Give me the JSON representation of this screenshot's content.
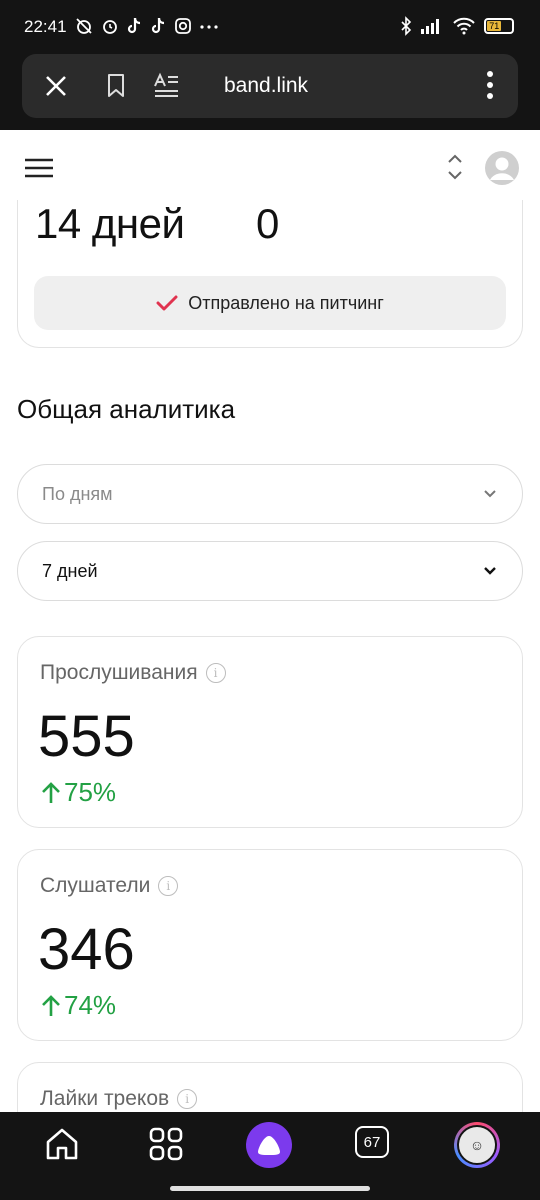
{
  "status_bar": {
    "time": "22:41",
    "battery_label": "71"
  },
  "browser": {
    "url": "band.link",
    "close_icon": "close-icon",
    "bookmark_icon": "bookmark-icon",
    "reader_icon": "reader-mode-icon",
    "menu_icon": "more-vertical-icon"
  },
  "header": {
    "menu_icon": "hamburger-icon",
    "sort_icon": "sort-updown-icon",
    "profile_icon": "profile-icon"
  },
  "pitching": {
    "days": "14 дней",
    "count": "0",
    "status": "Отправлено на питчинг",
    "status_color": "#e0334f"
  },
  "analytics": {
    "title": "Общая аналитика",
    "period_select": "По дням",
    "range_select": "7 дней",
    "cards": [
      {
        "label": "Прослушивания",
        "value": "555",
        "change": "75%"
      },
      {
        "label": "Слушатели",
        "value": "346",
        "change": "74%"
      },
      {
        "label": "Лайки треков"
      }
    ],
    "positive_color": "#23a144"
  },
  "bottom_nav": {
    "tabs_count": "67",
    "accent": "#7c3aed"
  }
}
